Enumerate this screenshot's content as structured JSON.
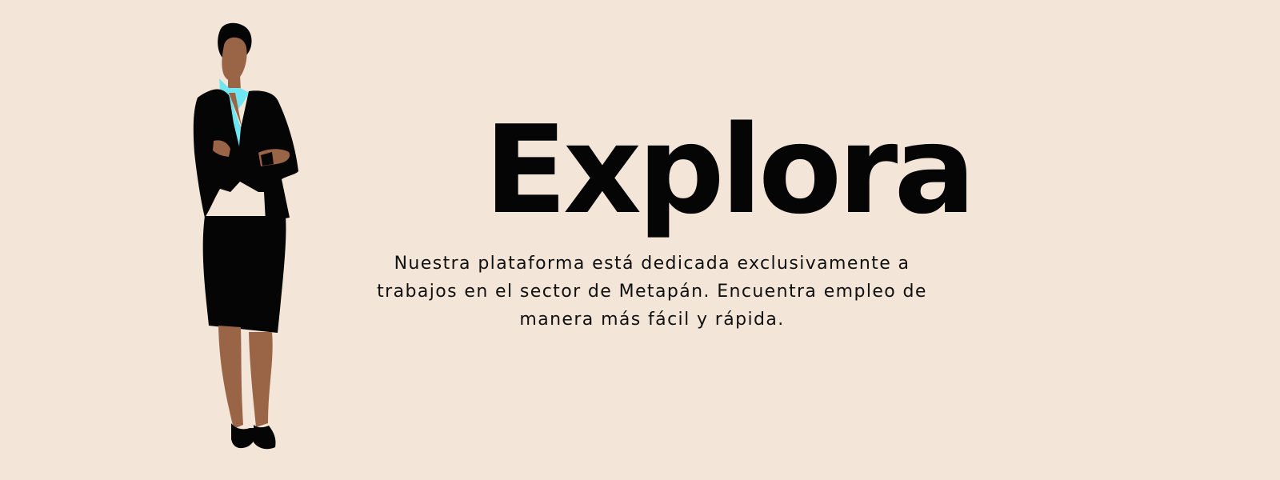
{
  "hero": {
    "title": "Explora",
    "description": "Nuestra plataforma está dedicada exclusivamente a trabajos en el sector de Metapán. Encuentra empleo de manera más fácil y rápida."
  },
  "illustration": {
    "icon": "professional-woman-illustration",
    "colors": {
      "background": "#f3e5d7",
      "skin": "#9a6447",
      "suit": "#050505",
      "collar": "#6ee7f2"
    }
  }
}
